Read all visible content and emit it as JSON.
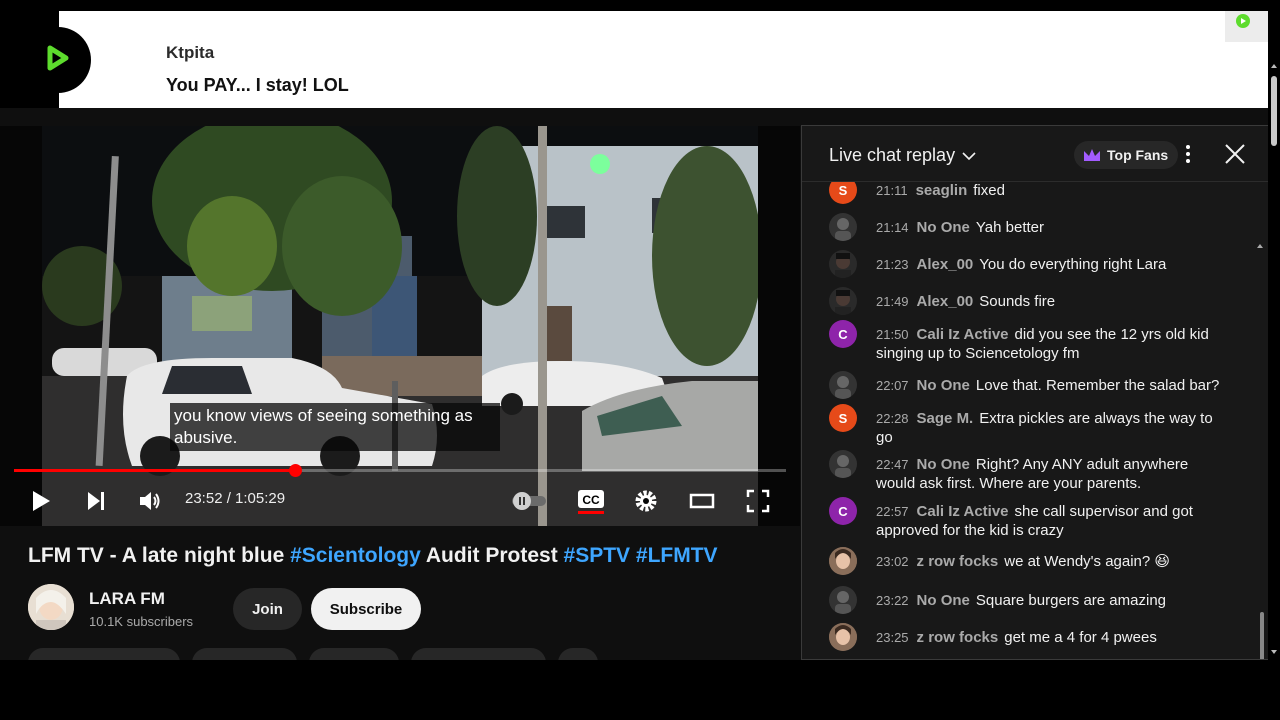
{
  "notification": {
    "app_icon": "play-logo-icon",
    "title": "Ktpita",
    "message": "You PAY... I stay! LOL"
  },
  "player": {
    "caption_text": "you know views of seeing something as abusive.",
    "current_time": "23:52",
    "duration": "1:05:29",
    "time_display": "23:52 / 1:05:29",
    "progress_fraction": 0.364,
    "accent_color": "#ff0000",
    "controls": [
      "play-icon",
      "next-icon",
      "volume-icon",
      "autoplay-toggle",
      "captions-icon",
      "settings-icon",
      "theater-mode-icon",
      "fullscreen-icon"
    ]
  },
  "video": {
    "title_main": "LFM TV - A late night blue ",
    "tag1": "#Scientology",
    "title_mid": " Audit Protest ",
    "tag2": "#SPTV",
    "tag3": "#LFMTV",
    "channel_name": "LARA FM",
    "subscribers": "10.1K subscribers",
    "join_label": "Join",
    "subscribe_label": "Subscribe"
  },
  "chat": {
    "title": "Live chat replay",
    "top_fans_label": "Top Fans",
    "messages": [
      {
        "time": "21:11",
        "author": "seaglin",
        "text": "fixed",
        "avatar_letter": "S",
        "avatar_color": "#e64a19"
      },
      {
        "time": "21:14",
        "author": "No One",
        "text": "Yah better",
        "avatar_letter": "",
        "avatar_color": "#333333"
      },
      {
        "time": "21:23",
        "author": "Alex_00",
        "text": "You do everything right Lara",
        "avatar_letter": "",
        "avatar_color": "#2a2a2a"
      },
      {
        "time": "21:49",
        "author": "Alex_00",
        "text": "Sounds fire",
        "avatar_letter": "",
        "avatar_color": "#2a2a2a"
      },
      {
        "time": "21:50",
        "author": "Cali Iz Active",
        "text": "did you see the 12 yrs old kid singing up to Sciencetology fm",
        "avatar_letter": "C",
        "avatar_color": "#8e24aa"
      },
      {
        "time": "22:07",
        "author": "No One",
        "text": "Love that. Remember the salad bar?",
        "avatar_letter": "",
        "avatar_color": "#333333"
      },
      {
        "time": "22:28",
        "author": "Sage M.",
        "text": "Extra pickles are always the way to go",
        "avatar_letter": "S",
        "avatar_color": "#e64a19"
      },
      {
        "time": "22:47",
        "author": "No One",
        "text": "Right? Any ANY adult anywhere would ask first. Where are your parents.",
        "avatar_letter": "",
        "avatar_color": "#333333"
      },
      {
        "time": "22:57",
        "author": "Cali Iz Active",
        "text": "she call supervisor and got approved for the kid is crazy",
        "avatar_letter": "C",
        "avatar_color": "#8e24aa"
      },
      {
        "time": "23:02",
        "author": "z row focks",
        "text": "we at Wendy's again? 😆",
        "avatar_letter": "",
        "avatar_color": "#6d5a4c"
      },
      {
        "time": "23:22",
        "author": "No One",
        "text": "Square burgers are amazing",
        "avatar_letter": "",
        "avatar_color": "#333333"
      },
      {
        "time": "23:25",
        "author": "z row focks",
        "text": "get me a 4 for 4 pwees",
        "avatar_letter": "",
        "avatar_color": "#6d5a4c"
      }
    ]
  }
}
